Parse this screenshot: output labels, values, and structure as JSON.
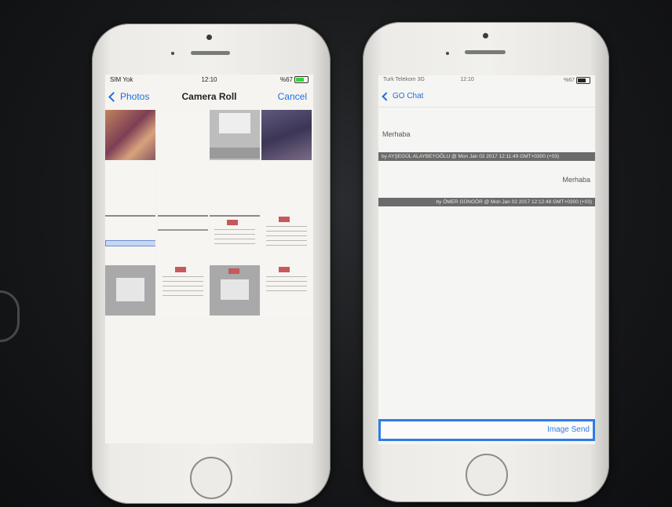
{
  "left_phone": {
    "status": {
      "carrier": "SIM Yok",
      "time": "12:10",
      "battery": "%67"
    },
    "nav": {
      "back_label": "Photos",
      "title": "Camera Roll",
      "cancel_label": "Cancel"
    }
  },
  "right_phone": {
    "status": {
      "carrier": "Turk Telekom 3G",
      "time": "12:10",
      "battery": "%67"
    },
    "nav": {
      "back_label": "GO Chat"
    },
    "messages": [
      {
        "text": "Merhaba",
        "meta": "by AYŞEGÜL ALAYBEYOĞLU @ Mon Jan 02 2017 12:11:49 GMT+0300 (+03)",
        "align": "left"
      },
      {
        "text": "Merhaba",
        "meta": "by ÖMER GÜNGÖR @ Mon Jan 02 2017 12:12:48 GMT+0300 (+03)",
        "align": "right"
      }
    ],
    "composer": {
      "placeholder": "",
      "send_label": "Image Send"
    }
  },
  "colors": {
    "accent": "#1e6fe0",
    "send_border": "#2f7be6",
    "meta_bar": "#6b6b6b"
  }
}
